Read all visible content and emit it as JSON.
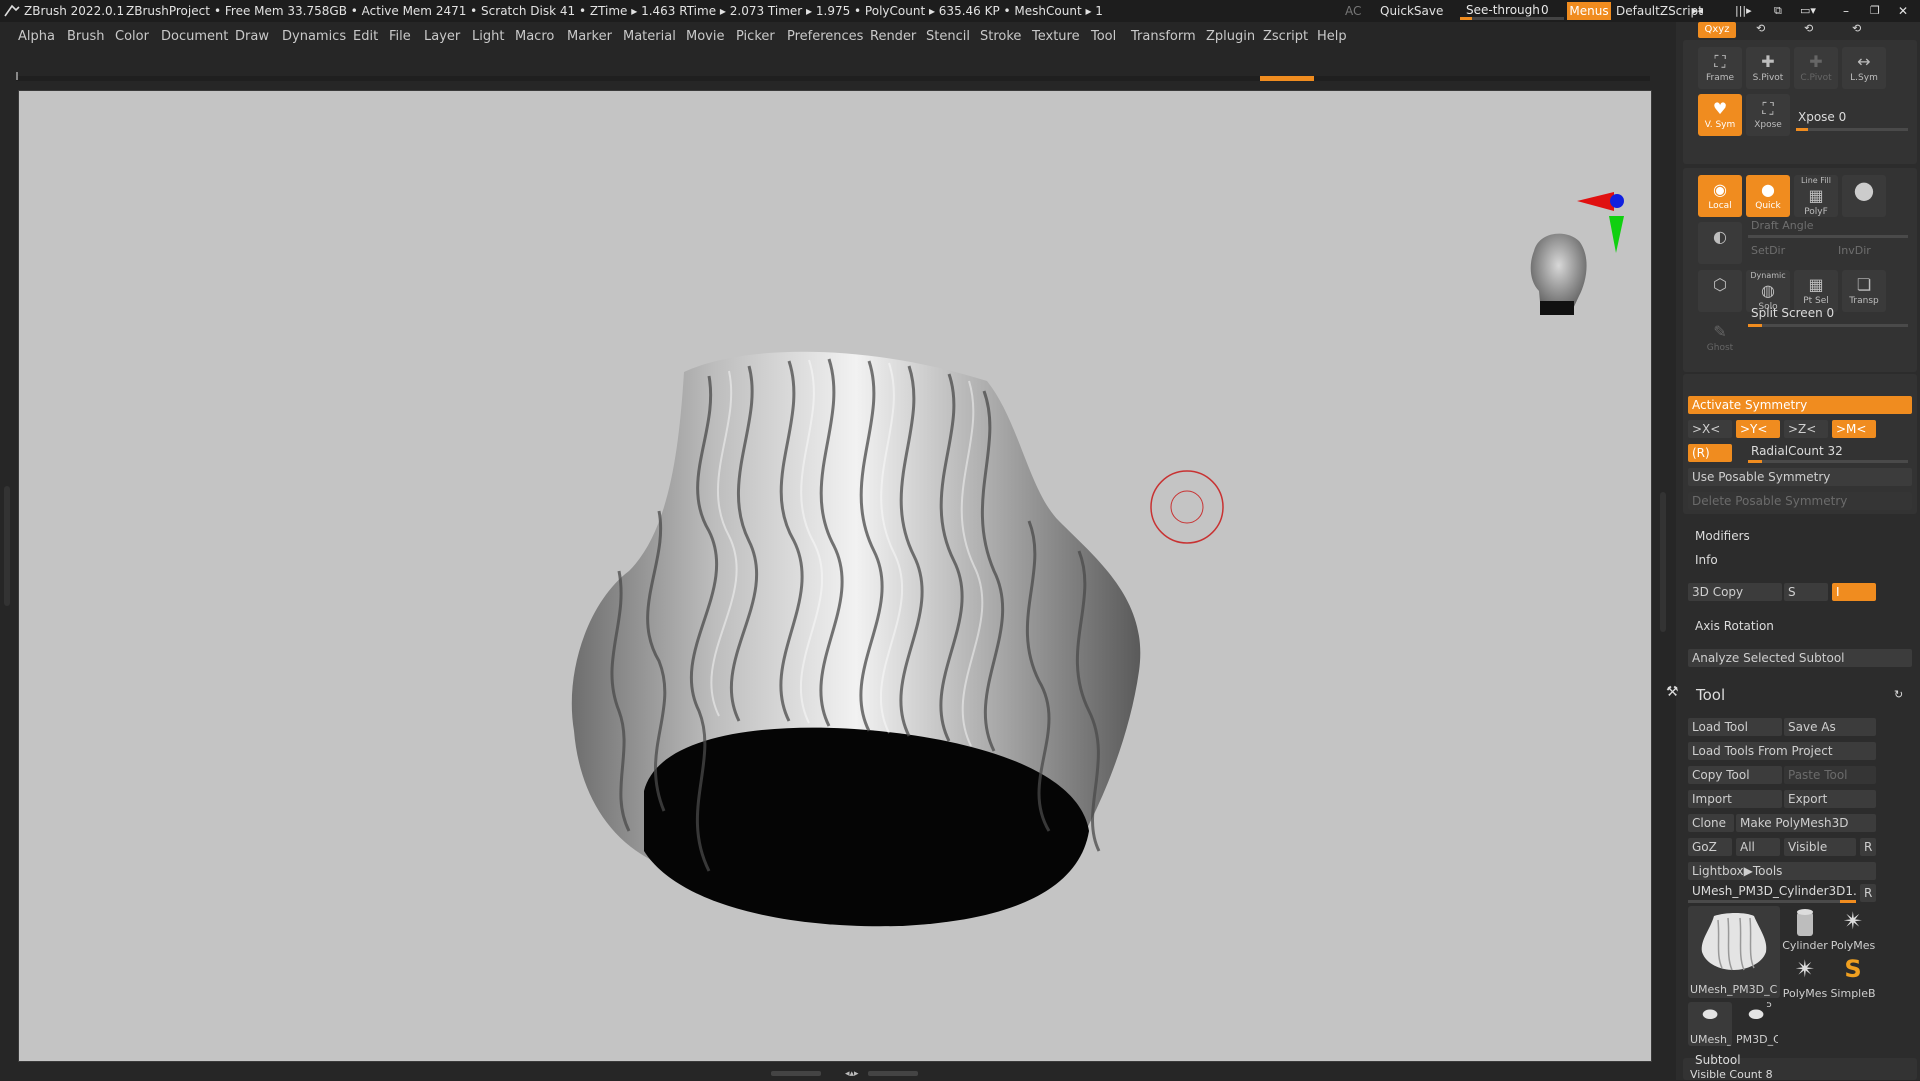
{
  "titlebar": {
    "app": "ZBrush 2022.0.1",
    "project": "ZBrushProject",
    "stats": "• Free Mem 33.758GB • Active Mem 2471 • Scratch Disk 41 • ZTime ▸ 1.463 RTime ▸ 2.073 Timer ▸ 1.975 • PolyCount ▸ 635.46 KP • MeshCount ▸ 1",
    "ac": "AC",
    "quicksave": "QuickSave",
    "seethrough_label": "See-through",
    "seethrough_value": "0",
    "seethrough_level": 0.0,
    "menus": "Menus",
    "script": "DefaultZScript",
    "icons": [
      "layout-icon",
      "brush-strip-icon",
      "spacer-icon",
      "window-icon",
      "popup-icon",
      "minimize-icon",
      "restore-icon",
      "close-icon"
    ]
  },
  "menubar": [
    "Alpha",
    "Brush",
    "Color",
    "Document",
    "Draw",
    "Dynamics",
    "Edit",
    "File",
    "Layer",
    "Light",
    "Macro",
    "Marker",
    "Material",
    "Movie",
    "Picker",
    "Preferences",
    "Render",
    "Stencil",
    "Stroke",
    "Texture",
    "Tool",
    "Transform",
    "Zplugin",
    "Zscript",
    "Help"
  ],
  "panel": {
    "top_tabs": [
      "Qxyz",
      "rot-icon",
      "rot2-icon",
      "rot3-icon"
    ],
    "frame": "Frame",
    "spivot": "S.Pivot",
    "cpivot": "C.Pivot",
    "lsym": "L.Sym",
    "vsym": "V. Sym",
    "xpose": "Xpose",
    "xpose_label": "Xpose",
    "xpose_value": "0",
    "local": "Local",
    "quick": "Quick",
    "linefill": "Line Fill",
    "polyf": "PolyF",
    "draft_angle": "Draft Angle",
    "setdir": "SetDir",
    "invdir": "InvDir",
    "dynamic": "Dynamic",
    "solo": "Solo",
    "ptsel": "Pt Sel",
    "transp": "Transp",
    "ghost": "Ghost",
    "split_label": "Split Screen",
    "split_value": "0",
    "activate_symmetry": "Activate Symmetry",
    "sym_x": ">X<",
    "sym_y": ">Y<",
    "sym_z": ">Z<",
    "sym_m": ">M<",
    "sym_r": "(R)",
    "radial_label": "RadialCount",
    "radial_value": "32",
    "use_posable": "Use Posable Symmetry",
    "delete_posable": "Delete Posable Symmetry",
    "modifiers": "Modifiers",
    "info": "Info",
    "copy3d": "3D Copy",
    "copy_s": "S",
    "copy_i": "I",
    "axis_rotation": "Axis Rotation",
    "analyze": "Analyze Selected Subtool"
  },
  "tool": {
    "title": "Tool",
    "load_tool": "Load Tool",
    "save_as": "Save As",
    "load_from_project": "Load Tools From Project",
    "copy_tool": "Copy Tool",
    "paste_tool": "Paste Tool",
    "import": "Import",
    "export": "Export",
    "clone": "Clone",
    "make_polymesh": "Make PolyMesh3D",
    "goz": "GoZ",
    "all": "All",
    "visible": "Visible",
    "r": "R",
    "lightbox": "Lightbox▶Tools",
    "current": "UMesh_PM3D_Cylinder3D1.",
    "current_r": "R",
    "thumbs": [
      {
        "label": "UMesh_PM3D_C"
      },
      {
        "label": "Cylinder"
      },
      {
        "label": "PolyMes"
      },
      {
        "label": "PolyMes"
      },
      {
        "label": "SimpleB"
      },
      {
        "label": "UMesh_"
      },
      {
        "label": "PM3D_C"
      }
    ],
    "thumb_count": "5",
    "subtool": "Subtool",
    "visible_count": "Visible Count 8"
  },
  "colors": {
    "accent": "#f08c1f",
    "bg": "#262626",
    "viewport": "#c4c4c4"
  }
}
